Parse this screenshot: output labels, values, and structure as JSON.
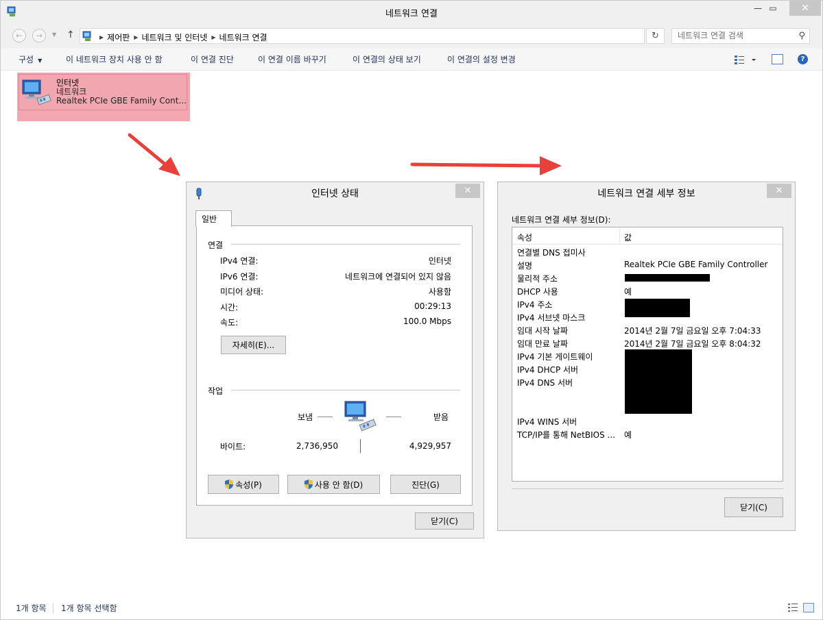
{
  "window": {
    "title": "네트워크 연결",
    "minimize": "—",
    "maximize": "▭",
    "close": "✕"
  },
  "nav": {
    "back": "←",
    "forward": "→",
    "recent": "▼",
    "up": "↑",
    "breadcrumbs": [
      "제어판",
      "네트워크 및 인터넷",
      "네트워크 연결"
    ],
    "dropdown": "▼",
    "refresh": "↻",
    "search_placeholder": "네트워크 연결 검색",
    "search_icon": "⚲"
  },
  "commandbar": {
    "organize": "구성",
    "caret": "▼",
    "items": [
      "이 네트워크 장치 사용 안 함",
      "이 연결 진단",
      "이 연결 이름 바꾸기",
      "이 연결의 상태 보기",
      "이 연결의 설정 변경"
    ],
    "help": "?"
  },
  "connection": {
    "name": "인터넷",
    "type": "네트워크",
    "adapter": "Realtek PCIe GBE Family Cont..."
  },
  "status_dialog": {
    "title": "인터넷 상태",
    "close": "✕",
    "tab": "일반",
    "connection_group": "연결",
    "rows": [
      {
        "label": "IPv4 연결:",
        "value": "인터넷"
      },
      {
        "label": "IPv6 연결:",
        "value": "네트워크에 연결되어 있지 않음"
      },
      {
        "label": "미디어 상태:",
        "value": "사용함"
      },
      {
        "label": "시간:",
        "value": "00:29:13"
      },
      {
        "label": "속도:",
        "value": "100.0 Mbps"
      }
    ],
    "details_button": "자세히(E)...",
    "activity_group": "작업",
    "sent_label": "보냄",
    "received_label": "받음",
    "bytes_label": "바이트:",
    "bytes_sent": "2,736,950",
    "bytes_received": "4,929,957",
    "properties_button": "속성(P)",
    "disable_button": "사용 안 함(D)",
    "diagnose_button": "진단(G)",
    "close_button": "닫기(C)"
  },
  "details_dialog": {
    "title": "네트워크 연결 세부 정보",
    "close": "✕",
    "list_label": "네트워크 연결 세부 정보(D):",
    "col_property": "속성",
    "col_value": "값",
    "rows": [
      {
        "property": "연결별 DNS 접미사",
        "value": ""
      },
      {
        "property": "설명",
        "value": "Realtek PCIe GBE Family Controller"
      },
      {
        "property": "물리적 주소",
        "value": ""
      },
      {
        "property": "DHCP 사용",
        "value": "예"
      },
      {
        "property": "IPv4 주소",
        "value": ""
      },
      {
        "property": "IPv4 서브넷 마스크",
        "value": ""
      },
      {
        "property": "임대 시작 날짜",
        "value": "2014년 2월 7일 금요일 오후 7:04:33"
      },
      {
        "property": "임대 만료 날짜",
        "value": "2014년 2월 7일 금요일 오후 8:04:32"
      },
      {
        "property": "IPv4 기본 게이트웨이",
        "value": ""
      },
      {
        "property": "IPv4 DHCP 서버",
        "value": ""
      },
      {
        "property": "IPv4 DNS 서버",
        "value": ""
      },
      {
        "property": "IPv4 WINS 서버",
        "value": ""
      },
      {
        "property": "TCP/IP를 통해 NetBIOS ...",
        "value": "예"
      }
    ],
    "close_button": "닫기(C)"
  },
  "statusbar": {
    "count": "1개 항목",
    "selected": "1개 항목 선택함"
  },
  "colors": {
    "selection": "#f2a7b0",
    "arrow": "#e8413b",
    "chrome": "#f0f0f0"
  },
  "icons": [
    "network-computer-icon",
    "shield-icon",
    "search-icon",
    "help-icon"
  ]
}
